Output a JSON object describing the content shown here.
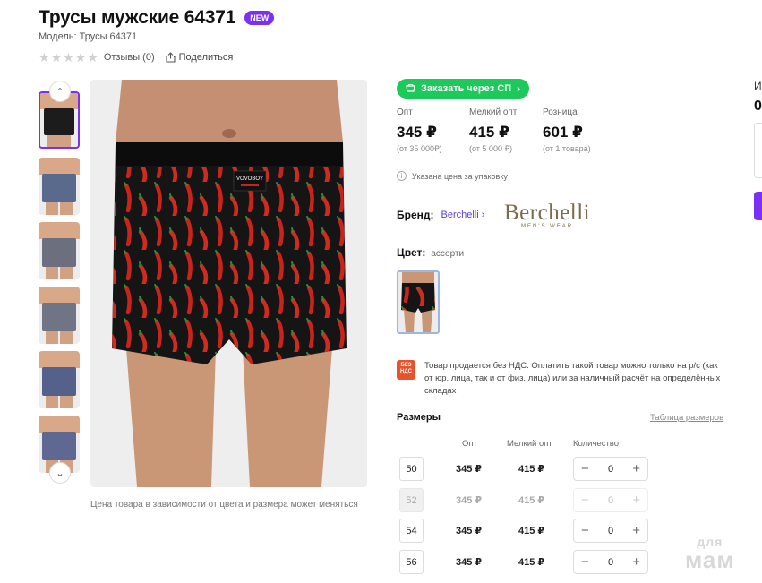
{
  "product": {
    "title": "Трусы мужские 64371",
    "badge": "NEW",
    "model": "Модель: Трусы 64371",
    "reviews": "Отзывы (0)",
    "share": "Поделиться"
  },
  "gallery": {
    "thumb_count": 6,
    "note": "Цена товара в зависимости от цвета и размера может меняться",
    "waistband_text": "VOVOBOY"
  },
  "order": {
    "button_label": "Заказать через СП"
  },
  "prices": [
    {
      "label": "Опт",
      "value": "345 ₽",
      "sub": "(от 35 000₽)"
    },
    {
      "label": "Мелкий опт",
      "value": "415 ₽",
      "sub": "(от 5 000 ₽)"
    },
    {
      "label": "Розница",
      "value": "601 ₽",
      "sub": "(от 1 товара)"
    }
  ],
  "pack_note": "Указана цена за упаковку",
  "brand": {
    "label": "Бренд:",
    "name": "Berchelli",
    "logo_name": "Berchelli",
    "logo_sub": "MEN'S WEAR"
  },
  "color": {
    "label": "Цвет:",
    "value": "ассорти"
  },
  "vat": {
    "icon_line1": "БЕЗ",
    "icon_line2": "НДС",
    "text": "Товар продается без НДС. Оплатить такой товар можно только на р/с (как от юр. лица, так и от физ. лица) или за наличный расчёт на определённых складах"
  },
  "sizes": {
    "title": "Размеры",
    "table_link": "Таблица размеров",
    "col_opt": "Опт",
    "col_small": "Мелкий опт",
    "col_qty": "Количество",
    "rows": [
      {
        "size": "50",
        "opt": "345 ₽",
        "small": "415 ₽",
        "qty": "0",
        "disabled": false
      },
      {
        "size": "52",
        "opt": "345 ₽",
        "small": "415 ₽",
        "qty": "0",
        "disabled": true
      },
      {
        "size": "54",
        "opt": "345 ₽",
        "small": "415 ₽",
        "qty": "0",
        "disabled": false
      },
      {
        "size": "56",
        "opt": "345 ₽",
        "small": "415 ₽",
        "qty": "0",
        "disabled": false
      }
    ],
    "minus": "−",
    "plus": "+"
  },
  "edge": {
    "text1": "И",
    "text2": "0"
  },
  "watermark": {
    "line1": "для",
    "line2": "мам"
  },
  "colors": {
    "accent": "#7b2ff7",
    "order_green": "#1ec95b",
    "vat_orange": "#e8532a",
    "brand_link": "#5a3fd6"
  }
}
